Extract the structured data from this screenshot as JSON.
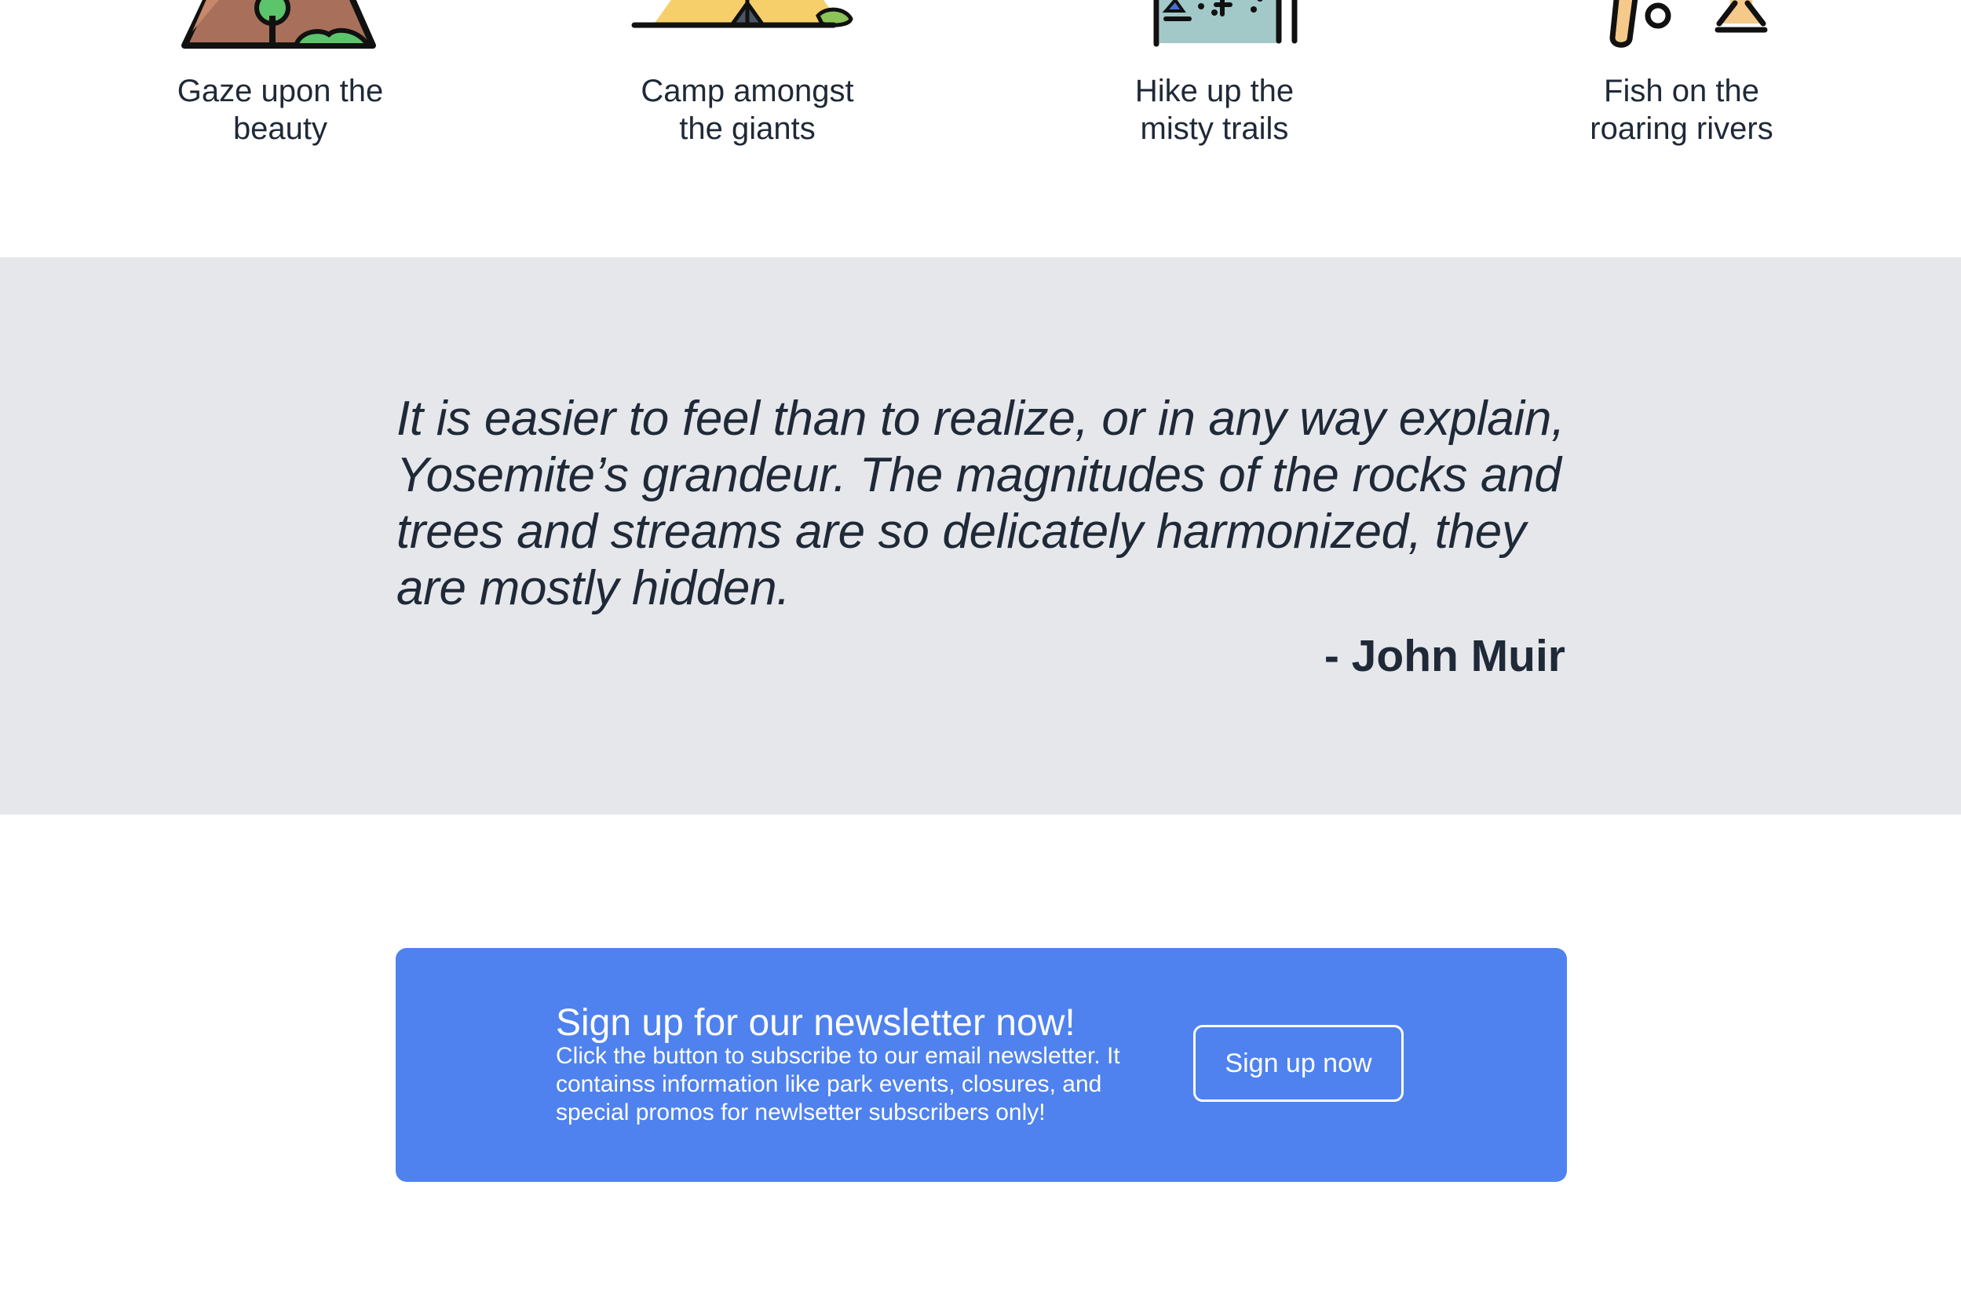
{
  "features": [
    {
      "icon": "mountain-icon",
      "line1": "Gaze upon the",
      "line2": "beauty"
    },
    {
      "icon": "tent-icon",
      "line1": "Camp amongst",
      "line2": "the giants"
    },
    {
      "icon": "hiking-trail-icon",
      "line1": "Hike up the",
      "line2": "misty trails"
    },
    {
      "icon": "fishing-icon",
      "line1": "Fish on the",
      "line2": "roaring rivers"
    }
  ],
  "quote": {
    "text": "It is easier to feel than to realize, or in any way explain, Yosemite’s grandeur. The magnitudes of the rocks and trees and streams are so delicately harmonized, they are mostly hidden.",
    "author": "- John Muir"
  },
  "newsletter": {
    "title": "Sign up for our newsletter now!",
    "description": "Click the button to subscribe to our email newsletter. It containss information like park events, closures, and special promos for newlsetter subscribers only!",
    "button_label": "Sign up now"
  },
  "colors": {
    "quote_background": "#e5e7eb",
    "newsletter_background": "#4f82ee",
    "text": "#1f2937"
  }
}
